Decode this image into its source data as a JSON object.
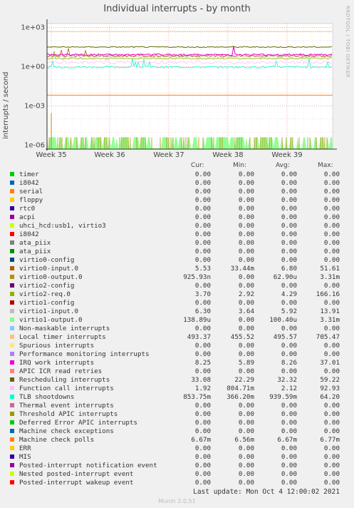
{
  "title": "Individual interrupts - by month",
  "watermark": "RRDTOOL / TOBI OETIKER",
  "footer": "Last update: Mon Oct  4 12:00:02 2021",
  "munin": "Munin 2.0.51",
  "legend_headers": {
    "cur": "Cur:",
    "min": "Min:",
    "avg": "Avg:",
    "max": "Max:"
  },
  "chart_data": {
    "type": "line",
    "title": "Individual interrupts - by month",
    "ylabel": "interrupts / second",
    "yscale": "log",
    "ylim": [
      5e-07,
      2000
    ],
    "yticks": [
      {
        "label": "1e+03",
        "value": 1000
      },
      {
        "label": "1e+00",
        "value": 1
      },
      {
        "label": "1e-03",
        "value": 0.001
      },
      {
        "label": "1e-06",
        "value": 1e-06
      }
    ],
    "xticks": [
      "Week 35",
      "Week 36",
      "Week 37",
      "Week 38",
      "Week 39"
    ],
    "grid": true,
    "series": [
      {
        "name": "timer",
        "color": "#00cc00",
        "cur": "0.00",
        "min": "0.00",
        "avg": "0.00",
        "max": "0.00"
      },
      {
        "name": "i8042",
        "color": "#0066b3",
        "cur": "0.00",
        "min": "0.00",
        "avg": "0.00",
        "max": "0.00"
      },
      {
        "name": "serial",
        "color": "#ff8000",
        "cur": "0.00",
        "min": "0.00",
        "avg": "0.00",
        "max": "0.00"
      },
      {
        "name": "floppy",
        "color": "#ffcc00",
        "cur": "0.00",
        "min": "0.00",
        "avg": "0.00",
        "max": "0.00"
      },
      {
        "name": "rtc0",
        "color": "#330099",
        "cur": "0.00",
        "min": "0.00",
        "avg": "0.00",
        "max": "0.00"
      },
      {
        "name": "acpi",
        "color": "#990099",
        "cur": "0.00",
        "min": "0.00",
        "avg": "0.00",
        "max": "0.00"
      },
      {
        "name": "uhci_hcd:usb1, virtio3",
        "color": "#ccff00",
        "cur": "0.00",
        "min": "0.00",
        "avg": "0.00",
        "max": "0.00"
      },
      {
        "name": "i8042",
        "color": "#ff0000",
        "cur": "0.00",
        "min": "0.00",
        "avg": "0.00",
        "max": "0.00"
      },
      {
        "name": "ata_piix",
        "color": "#808080",
        "cur": "0.00",
        "min": "0.00",
        "avg": "0.00",
        "max": "0.00"
      },
      {
        "name": "ata_piix",
        "color": "#008f00",
        "cur": "0.00",
        "min": "0.00",
        "avg": "0.00",
        "max": "0.00"
      },
      {
        "name": "virtio0-config",
        "color": "#00487d",
        "cur": "0.00",
        "min": "0.00",
        "avg": "0.00",
        "max": "0.00"
      },
      {
        "name": "virtio0-input.0",
        "color": "#b35a00",
        "cur": "5.53",
        "min": "33.44m",
        "avg": "6.80",
        "max": "51.61"
      },
      {
        "name": "virtio0-output.0",
        "color": "#b38f00",
        "cur": "925.93n",
        "min": "0.00",
        "avg": "62.90u",
        "max": "3.31m"
      },
      {
        "name": "virtio2-config",
        "color": "#6b006b",
        "cur": "0.00",
        "min": "0.00",
        "avg": "0.00",
        "max": "0.00"
      },
      {
        "name": "virtio2-req.0",
        "color": "#8fb300",
        "cur": "3.70",
        "min": "2.92",
        "avg": "4.29",
        "max": "166.16"
      },
      {
        "name": "virtio1-config",
        "color": "#b30000",
        "cur": "0.00",
        "min": "0.00",
        "avg": "0.00",
        "max": "0.00"
      },
      {
        "name": "virtio1-input.0",
        "color": "#bebebe",
        "cur": "6.30",
        "min": "3.64",
        "avg": "5.92",
        "max": "13.91"
      },
      {
        "name": "virtio1-output.0",
        "color": "#80ff80",
        "cur": "138.89u",
        "min": "0.00",
        "avg": "100.40u",
        "max": "3.31m"
      },
      {
        "name": "Non-maskable interrupts",
        "color": "#80c9ff",
        "cur": "0.00",
        "min": "0.00",
        "avg": "0.00",
        "max": "0.00"
      },
      {
        "name": "Local timer interrupts",
        "color": "#ffc080",
        "cur": "493.37",
        "min": "455.52",
        "avg": "495.57",
        "max": "705.47"
      },
      {
        "name": "Spurious interrupts",
        "color": "#ffe680",
        "cur": "0.00",
        "min": "0.00",
        "avg": "0.00",
        "max": "0.00"
      },
      {
        "name": "Performance monitoring interrupts",
        "color": "#aa80ff",
        "cur": "0.00",
        "min": "0.00",
        "avg": "0.00",
        "max": "0.00"
      },
      {
        "name": "IRQ work interrupts",
        "color": "#ee00cc",
        "cur": "8.25",
        "min": "5.89",
        "avg": "8.26",
        "max": "37.01"
      },
      {
        "name": "APIC ICR read retries",
        "color": "#ff8080",
        "cur": "0.00",
        "min": "0.00",
        "avg": "0.00",
        "max": "0.00"
      },
      {
        "name": "Rescheduling interrupts",
        "color": "#666600",
        "cur": "33.08",
        "min": "22.29",
        "avg": "32.32",
        "max": "59.22"
      },
      {
        "name": "Function call interrupts",
        "color": "#ffbfff",
        "cur": "1.92",
        "min": "804.71m",
        "avg": "2.12",
        "max": "92.93"
      },
      {
        "name": "TLB shootdowns",
        "color": "#00ffcc",
        "cur": "853.75m",
        "min": "366.20m",
        "avg": "939.59m",
        "max": "64.20"
      },
      {
        "name": "Thermal event interrupts",
        "color": "#cc6699",
        "cur": "0.00",
        "min": "0.00",
        "avg": "0.00",
        "max": "0.00"
      },
      {
        "name": "Threshold APIC interrupts",
        "color": "#999900",
        "cur": "0.00",
        "min": "0.00",
        "avg": "0.00",
        "max": "0.00"
      },
      {
        "name": "Deferred Error APIC interrupts",
        "color": "#00cc00",
        "cur": "0.00",
        "min": "0.00",
        "avg": "0.00",
        "max": "0.00"
      },
      {
        "name": "Machine check exceptions",
        "color": "#0066b3",
        "cur": "0.00",
        "min": "0.00",
        "avg": "0.00",
        "max": "0.00"
      },
      {
        "name": "Machine check polls",
        "color": "#ff8000",
        "cur": "6.67m",
        "min": "6.56m",
        "avg": "6.67m",
        "max": "6.77m"
      },
      {
        "name": "ERR",
        "color": "#ffcc00",
        "cur": "0.00",
        "min": "0.00",
        "avg": "0.00",
        "max": "0.00"
      },
      {
        "name": "MIS",
        "color": "#330099",
        "cur": "0.00",
        "min": "0.00",
        "avg": "0.00",
        "max": "0.00"
      },
      {
        "name": "Posted-interrupt notification event",
        "color": "#990099",
        "cur": "0.00",
        "min": "0.00",
        "avg": "0.00",
        "max": "0.00"
      },
      {
        "name": "Nested posted-interrupt event",
        "color": "#ccff00",
        "cur": "0.00",
        "min": "0.00",
        "avg": "0.00",
        "max": "0.00"
      },
      {
        "name": "Posted-interrupt wakeup event",
        "color": "#ff0000",
        "cur": "0.00",
        "min": "0.00",
        "avg": "0.00",
        "max": "0.00"
      }
    ]
  }
}
